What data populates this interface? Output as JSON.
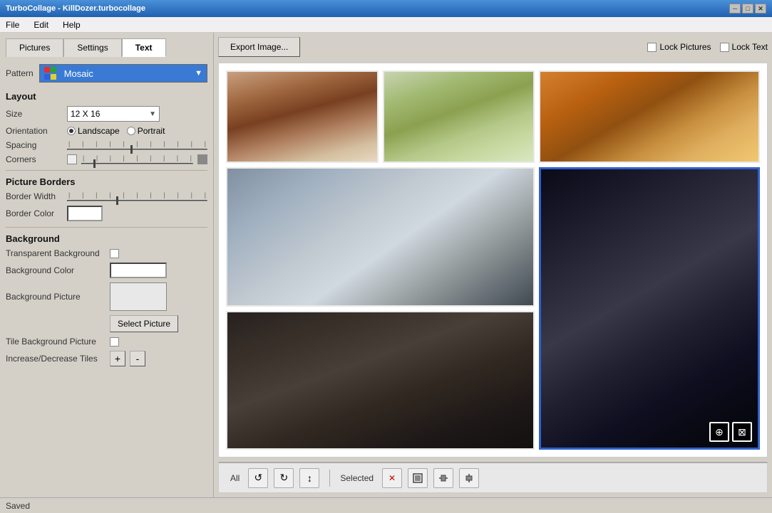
{
  "window": {
    "title": "TurboCollage - KillDozer.turbocollage",
    "controls": [
      "minimize",
      "maximize",
      "close"
    ]
  },
  "menu": {
    "items": [
      "File",
      "Edit",
      "Help"
    ]
  },
  "tabs": {
    "items": [
      "Pictures",
      "Settings",
      "Text"
    ],
    "active": "Text"
  },
  "pattern": {
    "label": "Pattern",
    "value": "Mosaic"
  },
  "layout": {
    "section": "Layout",
    "size_label": "Size",
    "size_value": "12 X 16",
    "orientation_label": "Orientation",
    "landscape_label": "Landscape",
    "portrait_label": "Portrait",
    "spacing_label": "Spacing",
    "corners_label": "Corners"
  },
  "borders": {
    "section": "Picture Borders",
    "border_width_label": "Border Width",
    "border_color_label": "Border Color"
  },
  "background": {
    "section": "Background",
    "transparent_label": "Transparent Background",
    "bg_color_label": "Background Color",
    "bg_picture_label": "Background Picture",
    "select_btn": "Select Picture",
    "tile_label": "Tile Background Picture",
    "increase_label": "Increase/Decrease Tiles",
    "plus_btn": "+",
    "minus_btn": "-"
  },
  "toolbar": {
    "export_btn": "Export Image...",
    "lock_pictures_label": "Lock Pictures",
    "lock_text_label": "Lock Text"
  },
  "bottom_toolbar": {
    "all_label": "All",
    "selected_label": "Selected"
  },
  "status": {
    "text": "Saved"
  }
}
